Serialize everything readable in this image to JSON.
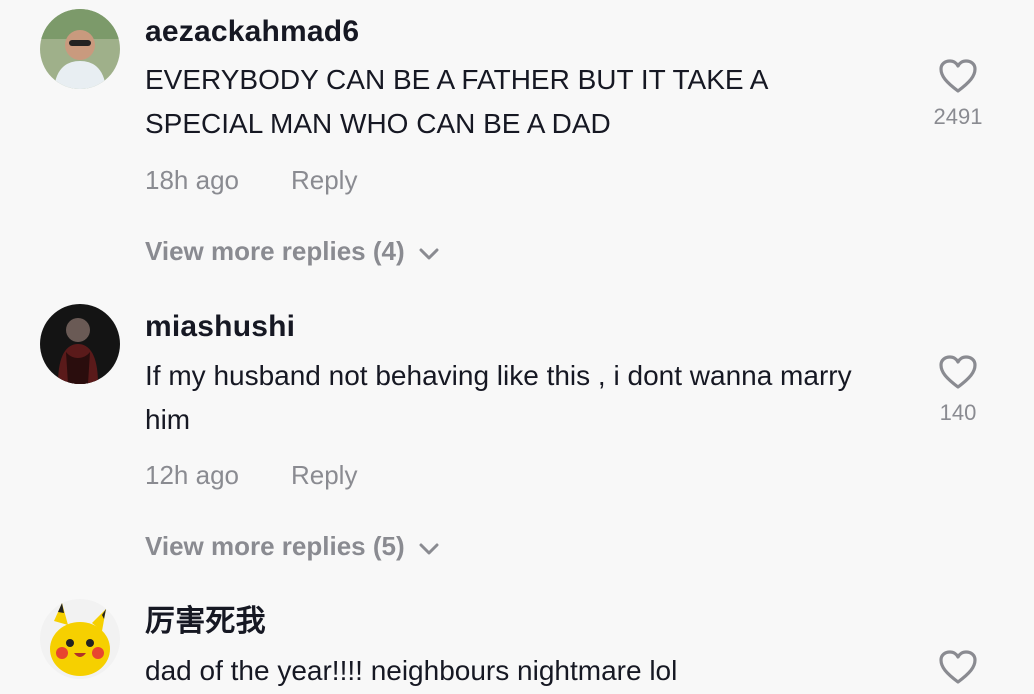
{
  "comments": [
    {
      "username": "aezackahmad6",
      "text": "EVERYBODY CAN BE A FATHER BUT IT TAKE A SPECIAL MAN WHO CAN BE A DAD",
      "time": "18h ago",
      "reply_label": "Reply",
      "likes": "2491",
      "view_more": "View more replies (4)",
      "avatar_icon": "man-with-sunglasses-avatar",
      "heart_icon": "heart-outline-icon"
    },
    {
      "username": "miashushi",
      "text": "If my husband not behaving like this , i dont wanna marry him",
      "time": "12h ago",
      "reply_label": "Reply",
      "likes": "140",
      "view_more": "View more replies (5)",
      "avatar_icon": "dark-portrait-avatar",
      "heart_icon": "heart-outline-icon"
    },
    {
      "username": "厉害死我",
      "text": "dad of the year!!!! neighbours nightmare lol",
      "avatar_icon": "pikachu-avatar",
      "heart_icon": "heart-outline-icon"
    }
  ],
  "colors": {
    "background": "#f8f8f8",
    "primary_text": "#161823",
    "secondary_text": "#8a8b91"
  }
}
